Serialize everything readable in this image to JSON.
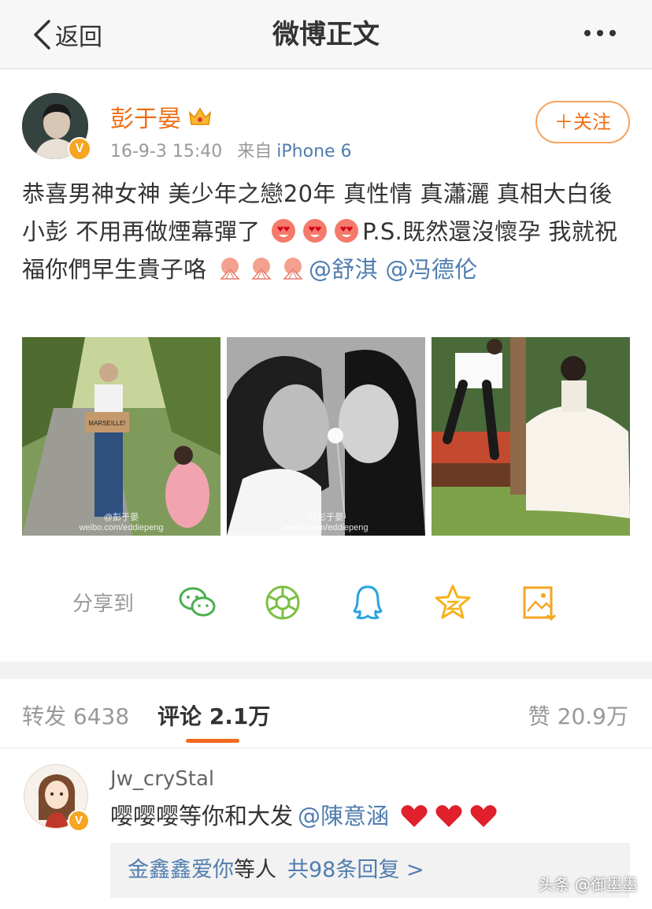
{
  "nav": {
    "back_label": "返回",
    "title": "微博正文",
    "more_icon": "more-dots-icon"
  },
  "post": {
    "author": "彭于晏",
    "author_badge": "crown-icon",
    "verified_mark": "V",
    "date": "16-9-3 15:40",
    "source_prefix": "来自",
    "source": "iPhone 6",
    "follow_label": "＋关注",
    "text_part1": "恭喜男神女神 美少年之戀20年 真性情 真瀟灑 真相大白後 小彭 不用再做煙幕彈了",
    "text_part2": "P.S.既然還沒懷孕 我就祝福你們早生貴子咯",
    "mention1": "@舒淇",
    "mention2": "@冯德伦",
    "photos": [
      {
        "watermark": "@彭于晏\nweibo.com/eddiepeng",
        "sign_text": "MARSEILLE!"
      },
      {
        "watermark": "@彭于晏\nweibo.com/eddiepeng"
      },
      {
        "watermark": ""
      }
    ]
  },
  "share": {
    "label": "分享到",
    "icons": [
      "wechat-icon",
      "moments-icon",
      "qq-icon",
      "qzone-icon",
      "save-image-icon"
    ]
  },
  "tabs": {
    "repost_label": "转发",
    "repost_count": "6438",
    "comment_label": "评论",
    "comment_count": "2.1万",
    "like_label": "赞",
    "like_count": "20.9万"
  },
  "comment": {
    "user": "Jw_cryStal",
    "verified_mark": "V",
    "text": "嘤嘤嘤等你和大发",
    "mention": "@陳意涵",
    "reply_name": "金鑫鑫爱你",
    "reply_text": "等人",
    "reply_count": "共98条回复 >"
  },
  "watermark": "头条 @御墨墨",
  "colors": {
    "orange": "#f06c13",
    "link_blue": "#507daf",
    "gray_text": "#999999",
    "heart_red": "#e0202a"
  }
}
